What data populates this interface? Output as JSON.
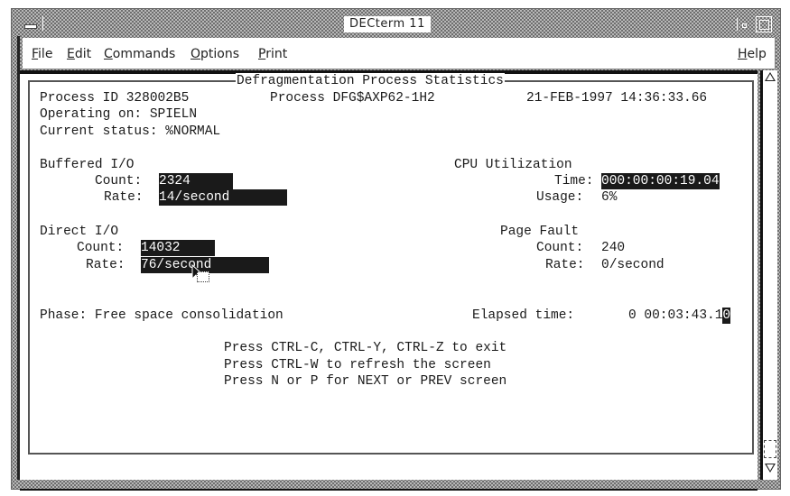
{
  "window": {
    "title": "DECterm 11"
  },
  "menubar": {
    "items": [
      {
        "label": "File",
        "mnemonic": "F",
        "rest": "ile"
      },
      {
        "label": "Edit",
        "mnemonic": "E",
        "rest": "dit"
      },
      {
        "label": "Commands",
        "mnemonic": "C",
        "rest": "ommands"
      },
      {
        "label": "Options",
        "mnemonic": "O",
        "rest": "ptions"
      },
      {
        "label": "Print",
        "mnemonic": "P",
        "rest": "rint"
      }
    ],
    "help": {
      "label": "Help",
      "mnemonic": "H",
      "rest": "elp"
    }
  },
  "terminal": {
    "frame_title": "Defragmentation Process Statistics",
    "header": {
      "process_id": "Process ID 328002B5",
      "process_name": "Process DFG$AXP62-1H2",
      "timestamp": "21-FEB-1997 14:36:33.66",
      "operating_on": "Operating on: SPIELN",
      "current_status": "Current status: %NORMAL"
    },
    "buffered_io": {
      "heading": "Buffered I/O",
      "count_label": "Count:",
      "count_value": "2324",
      "rate_label": "Rate:",
      "rate_value": "14/second"
    },
    "direct_io": {
      "heading": "Direct I/O",
      "count_label": "Count:",
      "count_value": "14032",
      "rate_label": "Rate:",
      "rate_value": "76/second"
    },
    "cpu": {
      "heading": "CPU Utilization",
      "time_label": "Time:",
      "time_value": "000:00:00:19.04",
      "usage_label": "Usage:",
      "usage_value": "6%"
    },
    "page_fault": {
      "heading": "Page Fault",
      "count_label": "Count:",
      "count_value": "240",
      "rate_label": "Rate:",
      "rate_value": "0/second"
    },
    "phase": "Phase: Free space consolidation",
    "elapsed_label": "Elapsed time:",
    "elapsed_value": "0 00:03:43.1",
    "elapsed_cursor_char": "0",
    "instructions": [
      "Press CTRL-C, CTRL-Y, CTRL-Z to exit",
      "Press CTRL-W to refresh the screen",
      "Press N or P for NEXT or PREV screen"
    ]
  }
}
